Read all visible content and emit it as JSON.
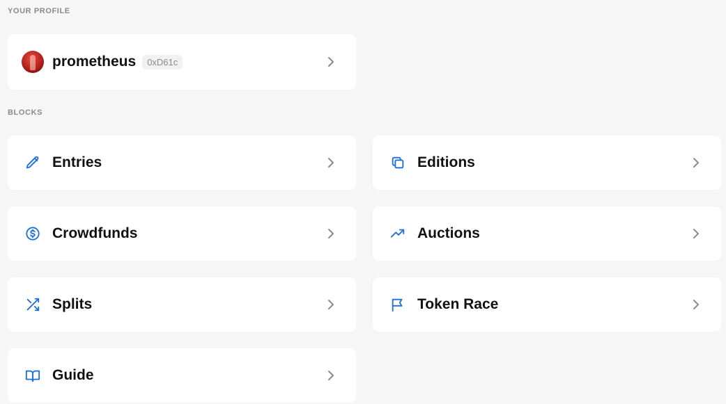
{
  "profile_section": {
    "heading": "YOUR PROFILE",
    "username": "prometheus",
    "address": "0xD61c"
  },
  "blocks_section": {
    "heading": "BLOCKS",
    "items": [
      {
        "label": "Entries",
        "icon": "pencil-icon"
      },
      {
        "label": "Editions",
        "icon": "copy-icon"
      },
      {
        "label": "Crowdfunds",
        "icon": "dollar-circle-icon"
      },
      {
        "label": "Auctions",
        "icon": "trending-up-icon"
      },
      {
        "label": "Splits",
        "icon": "shuffle-icon"
      },
      {
        "label": "Token Race",
        "icon": "flag-icon"
      },
      {
        "label": "Guide",
        "icon": "book-open-icon"
      }
    ]
  },
  "colors": {
    "accent": "#1a6fe0",
    "background": "#f6f6f6",
    "card": "#ffffff",
    "muted_text": "#8a8a8a",
    "chevron": "#8a8a8a"
  }
}
